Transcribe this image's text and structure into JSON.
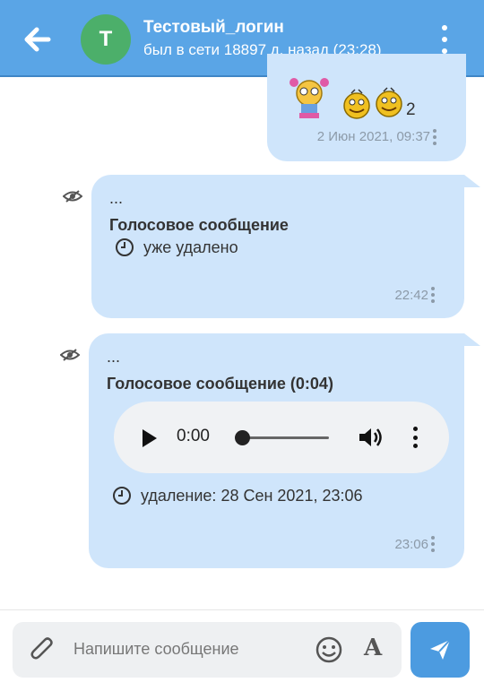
{
  "header": {
    "avatar_letter": "Т",
    "title": "Тестовый_логин",
    "subtitle": "был в сети 18897 д. назад (23:28)"
  },
  "messages": [
    {
      "sticker_count": "2",
      "timestamp": "2 Июн 2021, 09:37"
    },
    {
      "preview": "...",
      "type_label": "Голосовое сообщение",
      "status": "уже удалено",
      "timestamp": "22:42"
    },
    {
      "preview": "...",
      "type_label": "Голосовое сообщение (0:04)",
      "player_time": "0:00",
      "status": "удаление: 28 Сен 2021, 23:06",
      "timestamp": "23:06"
    }
  ],
  "composer": {
    "placeholder": "Напишите сообщение",
    "format_glyph": "A"
  },
  "colors": {
    "header": "#5aa5e6",
    "bubble": "#cfe5fb",
    "send": "#4c9be0",
    "avatar": "#4caf6a"
  }
}
